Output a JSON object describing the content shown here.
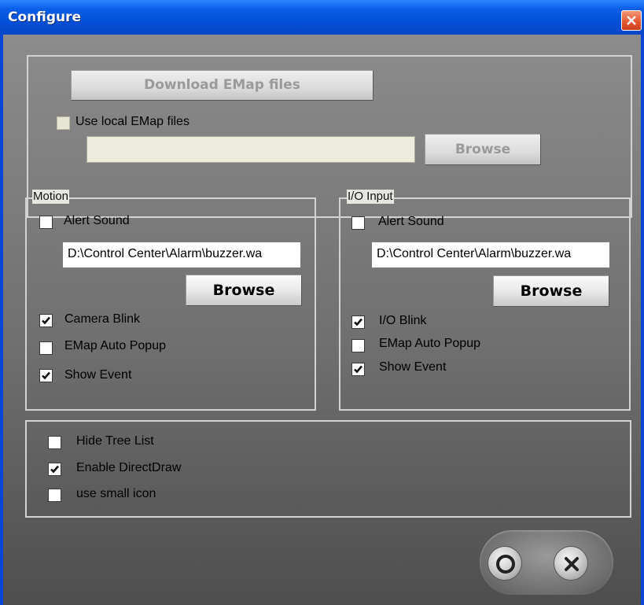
{
  "window": {
    "title": "Configure"
  },
  "emap": {
    "download_label": "Download EMap files",
    "use_local_label": "Use local EMap files",
    "use_local_checked": false,
    "path_value": "",
    "browse_label": "Browse"
  },
  "motion": {
    "legend": "Motion",
    "alert_sound_label": "Alert Sound",
    "alert_sound_checked": false,
    "path_value": "D:\\Control Center\\Alarm\\buzzer.wa",
    "browse_label": "Browse",
    "camera_blink_label": "Camera Blink",
    "camera_blink_checked": true,
    "emap_popup_label": "EMap Auto Popup",
    "emap_popup_checked": false,
    "show_event_label": "Show Event",
    "show_event_checked": true
  },
  "io_input": {
    "legend": "I/O Input",
    "alert_sound_label": "Alert Sound",
    "alert_sound_checked": false,
    "path_value": "D:\\Control Center\\Alarm\\buzzer.wa",
    "browse_label": "Browse",
    "io_blink_label": "I/O Blink",
    "io_blink_checked": true,
    "emap_popup_label": "EMap Auto Popup",
    "emap_popup_checked": false,
    "show_event_label": "Show Event",
    "show_event_checked": true
  },
  "general": {
    "hide_tree_label": "Hide Tree List",
    "hide_tree_checked": false,
    "direct_draw_label": "Enable DirectDraw",
    "direct_draw_checked": true,
    "small_icon_label": "use small icon",
    "small_icon_checked": false
  },
  "footer": {
    "ok_icon": "ok-circle-icon",
    "cancel_icon": "cancel-x-icon"
  }
}
